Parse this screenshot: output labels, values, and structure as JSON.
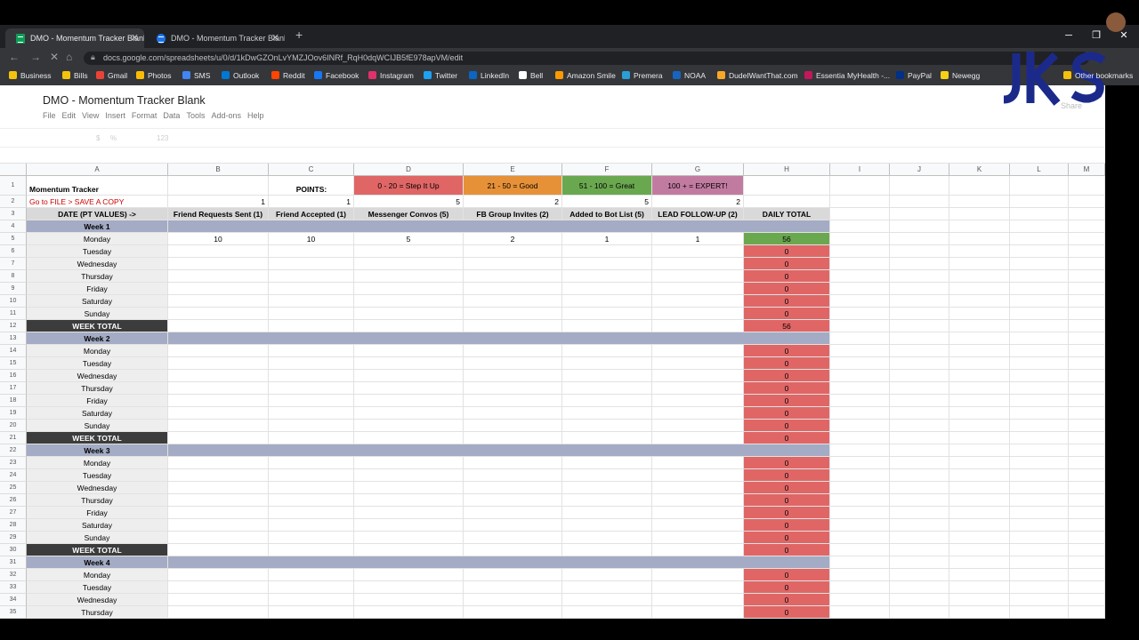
{
  "browser": {
    "tabs": [
      {
        "title": "DMO - Momentum Tracker Blank",
        "active": true
      },
      {
        "title": "DMO - Momentum Tracker Blank",
        "active": false
      }
    ],
    "url": "docs.google.com/spreadsheets/u/0/d/1kDwGZOnLvYMZJOov6INRf_RqH0dqWCIJB5fE978apVM/edit",
    "bookmarks": [
      "Business",
      "Bills",
      "Gmail",
      "Photos",
      "SMS",
      "Outlook",
      "Reddit",
      "Facebook",
      "Instagram",
      "Twitter",
      "LinkedIn",
      "Bell",
      "Amazon Smile",
      "Premera",
      "NOAA",
      "DudeIWantThat.com",
      "Essentia MyHealth -...",
      "PayPal",
      "Newegg",
      "Other bookmarks"
    ],
    "bookmark_colors": [
      "#f4c20d",
      "#f4c20d",
      "#ea4335",
      "#fbbc04",
      "#4285f4",
      "#0078d4",
      "#ff4500",
      "#1877f2",
      "#e1306c",
      "#1da1f2",
      "#0a66c2",
      "#ffffff",
      "#ff9900",
      "#2a9fd6",
      "#1565c0",
      "#f9a825",
      "#c2185b",
      "#003087",
      "#f7d117",
      "#f4c20d"
    ]
  },
  "sheet": {
    "title": "DMO - Momentum Tracker Blank",
    "menu": [
      "File",
      "Edit",
      "View",
      "Insert",
      "Format",
      "Data",
      "Tools",
      "Add-ons",
      "Help"
    ],
    "share_label": "Share",
    "toolbar_items": [
      "$",
      "%",
      "123"
    ],
    "columns": [
      "A",
      "B",
      "C",
      "D",
      "E",
      "F",
      "G",
      "H",
      "I",
      "J",
      "K",
      "L",
      "M"
    ],
    "row_numbers": [
      "1",
      "2",
      "3",
      "4",
      "5",
      "6",
      "7",
      "8",
      "9",
      "10",
      "11",
      "12",
      "13",
      "14",
      "15",
      "16",
      "17",
      "18",
      "19",
      "20",
      "21",
      "22",
      "23",
      "24",
      "25",
      "26",
      "27",
      "28",
      "29",
      "30",
      "31",
      "32",
      "33",
      "34",
      "35"
    ],
    "row1": {
      "a": "Momentum Tracker",
      "c": "POINTS:",
      "d": "0 - 20 = Step It Up",
      "e": "21 - 50 = Good",
      "f": "51 - 100 = Great",
      "g": "100 + = EXPERT!"
    },
    "row2": {
      "a": "Go to FILE > SAVE A COPY",
      "b": "1",
      "c": "1",
      "d": "5",
      "e": "2",
      "f": "5",
      "g": "2"
    },
    "headers": [
      "DATE (PT VALUES) ->",
      "Friend Requests Sent (1)",
      "Friend Accepted (1)",
      "Messenger Convos (5)",
      "FB Group Invites (2)",
      "Added to Bot List (5)",
      "LEAD FOLLOW-UP (2)",
      "DAILY TOTAL"
    ],
    "rows": [
      {
        "type": "week",
        "label": "Week 1"
      },
      {
        "type": "day",
        "label": "Monday",
        "values": [
          "10",
          "10",
          "5",
          "2",
          "1",
          "1"
        ],
        "total": "56",
        "total_status": "green"
      },
      {
        "type": "day",
        "label": "Tuesday",
        "total": "0"
      },
      {
        "type": "day",
        "label": "Wednesday",
        "total": "0"
      },
      {
        "type": "day",
        "label": "Thursday",
        "total": "0"
      },
      {
        "type": "day",
        "label": "Friday",
        "total": "0"
      },
      {
        "type": "day",
        "label": "Saturday",
        "total": "0"
      },
      {
        "type": "day",
        "label": "Sunday",
        "total": "0"
      },
      {
        "type": "weektotal",
        "label": "WEEK TOTAL",
        "total": "56"
      },
      {
        "type": "week",
        "label": "Week 2"
      },
      {
        "type": "day",
        "label": "Monday",
        "total": "0"
      },
      {
        "type": "day",
        "label": "Tuesday",
        "total": "0"
      },
      {
        "type": "day",
        "label": "Wednesday",
        "total": "0"
      },
      {
        "type": "day",
        "label": "Thursday",
        "total": "0"
      },
      {
        "type": "day",
        "label": "Friday",
        "total": "0"
      },
      {
        "type": "day",
        "label": "Saturday",
        "total": "0"
      },
      {
        "type": "day",
        "label": "Sunday",
        "total": "0"
      },
      {
        "type": "weektotal",
        "label": "WEEK TOTAL",
        "total": "0"
      },
      {
        "type": "week",
        "label": "Week 3"
      },
      {
        "type": "day",
        "label": "Monday",
        "total": "0"
      },
      {
        "type": "day",
        "label": "Tuesday",
        "total": "0"
      },
      {
        "type": "day",
        "label": "Wednesday",
        "total": "0"
      },
      {
        "type": "day",
        "label": "Thursday",
        "total": "0"
      },
      {
        "type": "day",
        "label": "Friday",
        "total": "0"
      },
      {
        "type": "day",
        "label": "Saturday",
        "total": "0"
      },
      {
        "type": "day",
        "label": "Sunday",
        "total": "0"
      },
      {
        "type": "weektotal",
        "label": "WEEK TOTAL",
        "total": "0"
      },
      {
        "type": "week",
        "label": "Week 4"
      },
      {
        "type": "day",
        "label": "Monday",
        "total": "0"
      },
      {
        "type": "day",
        "label": "Tuesday",
        "total": "0"
      },
      {
        "type": "day",
        "label": "Wednesday",
        "total": "0"
      },
      {
        "type": "day",
        "label": "Thursday",
        "total": "0"
      }
    ]
  },
  "colors": {
    "step_it_up": "#e06666",
    "good": "#e69138",
    "great": "#6aa84f",
    "expert": "#c27ba0",
    "week_band": "#a4abc4",
    "week_total": "#3c3c3c",
    "header_gray": "#d9d9d9",
    "date_col": "#eeeeee",
    "total_red": "#e06666",
    "total_green": "#6aa84f"
  }
}
